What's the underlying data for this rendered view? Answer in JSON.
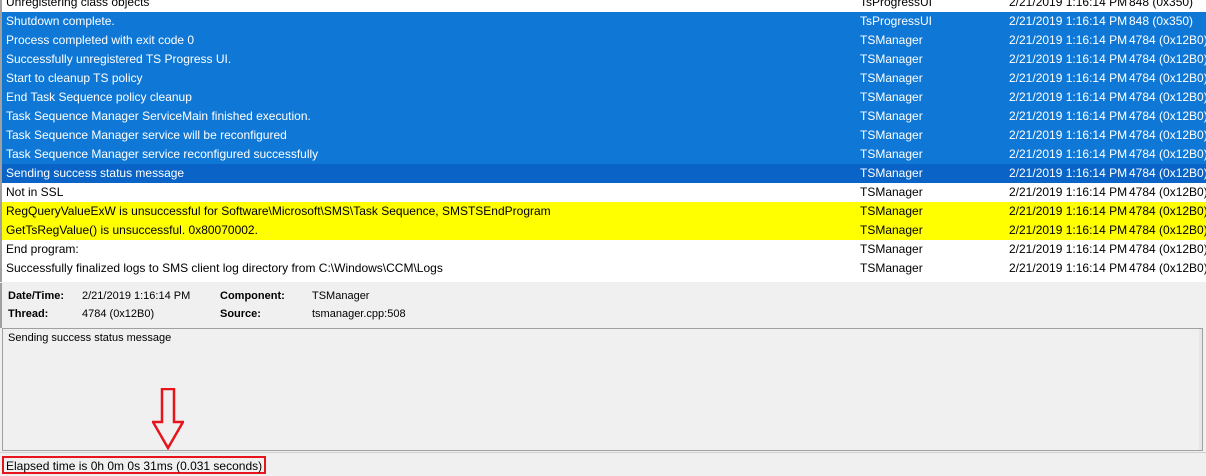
{
  "log": {
    "rows": [
      {
        "message": "Unregistering class objects",
        "component": "TsProgressUI",
        "datetime": "2/21/2019 1:16:14 PM",
        "thread": "848 (0x350)",
        "state": "normal"
      },
      {
        "message": "Shutdown complete.",
        "component": "TsProgressUI",
        "datetime": "2/21/2019 1:16:14 PM",
        "thread": "848 (0x350)",
        "state": "selected"
      },
      {
        "message": "Process completed with exit code 0",
        "component": "TSManager",
        "datetime": "2/21/2019 1:16:14 PM",
        "thread": "4784 (0x12B0)",
        "state": "selected"
      },
      {
        "message": "Successfully unregistered TS Progress UI.",
        "component": "TSManager",
        "datetime": "2/21/2019 1:16:14 PM",
        "thread": "4784 (0x12B0)",
        "state": "selected"
      },
      {
        "message": "Start to cleanup TS policy",
        "component": "TSManager",
        "datetime": "2/21/2019 1:16:14 PM",
        "thread": "4784 (0x12B0)",
        "state": "selected"
      },
      {
        "message": "End Task Sequence policy cleanup",
        "component": "TSManager",
        "datetime": "2/21/2019 1:16:14 PM",
        "thread": "4784 (0x12B0)",
        "state": "selected"
      },
      {
        "message": "Task Sequence Manager ServiceMain finished execution.",
        "component": "TSManager",
        "datetime": "2/21/2019 1:16:14 PM",
        "thread": "4784 (0x12B0)",
        "state": "selected"
      },
      {
        "message": "Task Sequence Manager service will be reconfigured",
        "component": "TSManager",
        "datetime": "2/21/2019 1:16:14 PM",
        "thread": "4784 (0x12B0)",
        "state": "selected"
      },
      {
        "message": "Task Sequence Manager service reconfigured successfully",
        "component": "TSManager",
        "datetime": "2/21/2019 1:16:14 PM",
        "thread": "4784 (0x12B0)",
        "state": "selected"
      },
      {
        "message": "Sending success status message",
        "component": "TSManager",
        "datetime": "2/21/2019 1:16:14 PM",
        "thread": "4784 (0x12B0)",
        "state": "focused"
      },
      {
        "message": "Not in SSL",
        "component": "TSManager",
        "datetime": "2/21/2019 1:16:14 PM",
        "thread": "4784 (0x12B0)",
        "state": "normal"
      },
      {
        "message": "RegQueryValueExW is unsuccessful for Software\\Microsoft\\SMS\\Task Sequence, SMSTSEndProgram",
        "component": "TSManager",
        "datetime": "2/21/2019 1:16:14 PM",
        "thread": "4784 (0x12B0)",
        "state": "warning"
      },
      {
        "message": "GetTsRegValue() is unsuccessful. 0x80070002.",
        "component": "TSManager",
        "datetime": "2/21/2019 1:16:14 PM",
        "thread": "4784 (0x12B0)",
        "state": "warning"
      },
      {
        "message": "End program:",
        "component": "TSManager",
        "datetime": "2/21/2019 1:16:14 PM",
        "thread": "4784 (0x12B0)",
        "state": "normal"
      },
      {
        "message": "Successfully finalized logs to SMS client log directory from C:\\Windows\\CCM\\Logs",
        "component": "TSManager",
        "datetime": "2/21/2019 1:16:14 PM",
        "thread": "4784 (0x12B0)",
        "state": "normal"
      }
    ]
  },
  "detail": {
    "datetime_label": "Date/Time:",
    "datetime_value": "2/21/2019 1:16:14 PM",
    "component_label": "Component:",
    "component_value": "TSManager",
    "thread_label": "Thread:",
    "thread_value": "4784 (0x12B0)",
    "source_label": "Source:",
    "source_value": "tsmanager.cpp:508"
  },
  "message_box": {
    "text": "Sending success status message"
  },
  "status_bar": {
    "elapsed": "Elapsed time is 0h 0m 0s 31ms (0.031 seconds)"
  },
  "annotation": {
    "arrow_icon": "down-arrow-icon",
    "highlight_color": "#e8141c"
  },
  "colors": {
    "selection": "#0f78d7",
    "focused": "#0a64c8",
    "warning": "#ffff00"
  }
}
